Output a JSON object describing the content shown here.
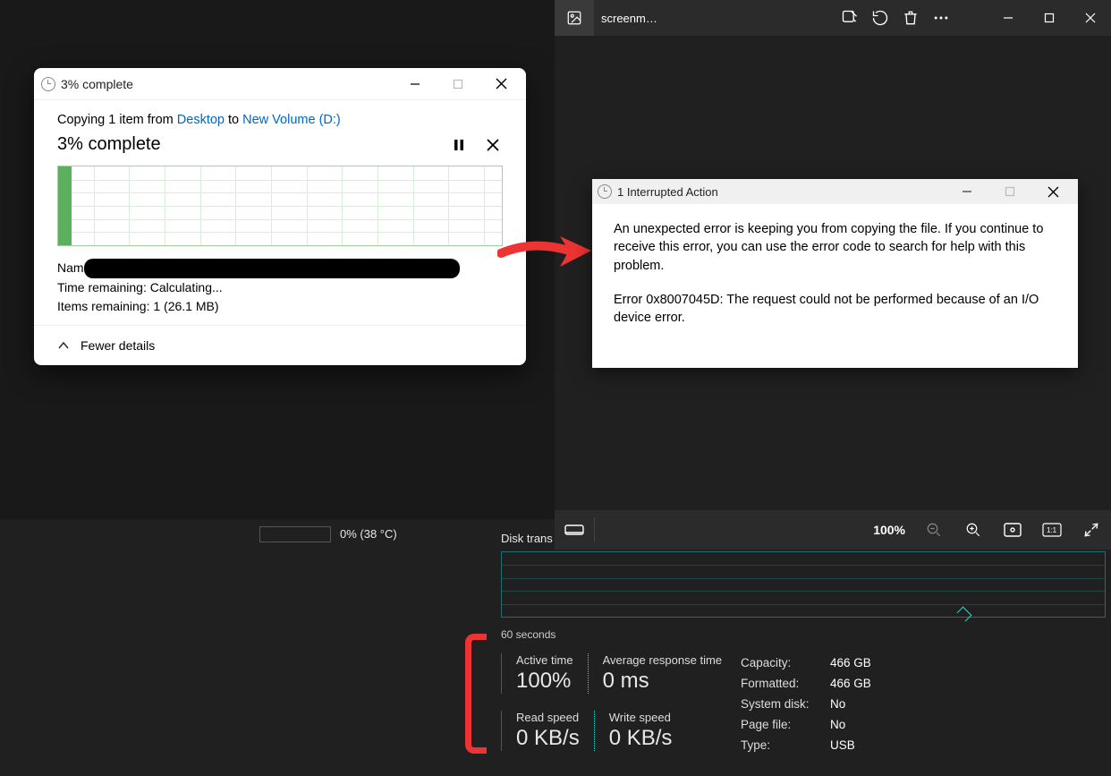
{
  "photos": {
    "title": "screenm…",
    "zoom": "100%"
  },
  "copyDialog": {
    "title": "3% complete",
    "copying_prefix": "Copying 1 item from ",
    "from_link": "Desktop",
    "to_word": " to ",
    "to_link": "New Volume (D:)",
    "heading": "3% complete",
    "progress_percent": 3,
    "name_label": "Nam",
    "time_remaining": "Time remaining:  Calculating...",
    "items_remaining": "Items remaining:  1 (26.1 MB)",
    "footer": "Fewer details"
  },
  "errorDialog": {
    "title": "1 Interrupted Action",
    "para1": "An unexpected error is keeping you from copying the file. If you continue to receive this error, you can use the error code to search for help with this problem.",
    "para2": "Error 0x8007045D: The request could not be performed because of an I/O device error."
  },
  "taskmgr": {
    "gpu_text": "0%  (38 °C)",
    "disk_label": "Disk trans",
    "time_axis": "60 seconds",
    "active_time_label": "Active time",
    "active_time_value": "100%",
    "avg_resp_label": "Average response time",
    "avg_resp_value": "0 ms",
    "read_label": "Read speed",
    "read_value": "0 KB/s",
    "write_label": "Write speed",
    "write_value": "0 KB/s",
    "info": {
      "capacity_k": "Capacity:",
      "capacity_v": "466 GB",
      "formatted_k": "Formatted:",
      "formatted_v": "466 GB",
      "sysdisk_k": "System disk:",
      "sysdisk_v": "No",
      "pagefile_k": "Page file:",
      "pagefile_v": "No",
      "type_k": "Type:",
      "type_v": "USB"
    }
  }
}
